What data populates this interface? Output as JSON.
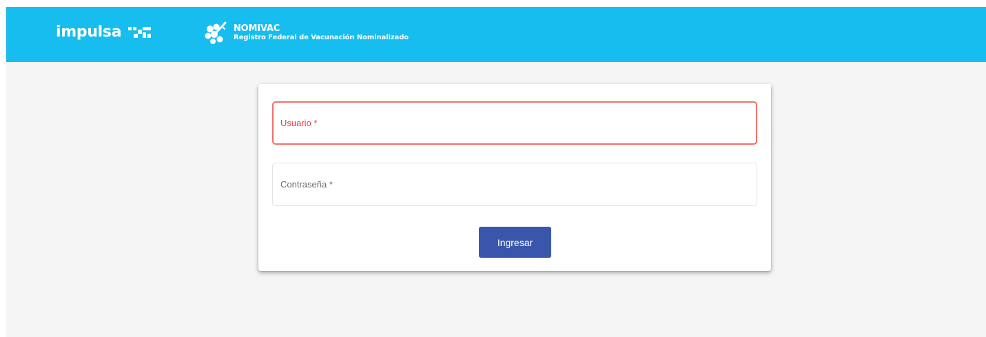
{
  "header": {
    "brand": {
      "wordmark": "impulsa",
      "mark_icon": "impulsa-mark-icon"
    },
    "program": {
      "logo_icon": "vaccine-flower-icon",
      "name": "NOMIVAC",
      "subtitle": "Registro Federal de Vacunación Nominalizado"
    },
    "background_color": "#18bdf0"
  },
  "login_form": {
    "username": {
      "label": "Usuario *",
      "value": "",
      "error_color": "#e8423f"
    },
    "password": {
      "label": "Contraseña *",
      "value": ""
    },
    "submit_label": "Ingresar",
    "submit_color": "#3a56ac"
  }
}
